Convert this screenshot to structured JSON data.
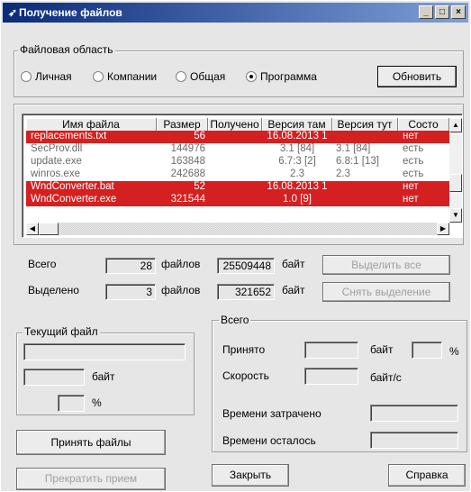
{
  "window": {
    "title": "Получение файлов",
    "btn_min": "_",
    "btn_max": "□",
    "btn_close": "×"
  },
  "area": {
    "legend": "Файловая область",
    "options": [
      "Личная",
      "Компании",
      "Общая",
      "Программа"
    ],
    "selected": "Программа",
    "refresh_label": "Обновить"
  },
  "files": {
    "columns": [
      "Имя файла",
      "Размер",
      "Получено",
      "Версия там",
      "Версия тут",
      "Состо"
    ],
    "rows": [
      {
        "name": "replacements.txt",
        "size": "56",
        "received": "",
        "ver_there": "16.08.2013 1",
        "ver_here": "",
        "state": "нет",
        "style": "red"
      },
      {
        "name": "SecProv.dll",
        "size": "144976",
        "received": "",
        "ver_there": "3.1 [84]",
        "ver_here": "3.1 [84]",
        "state": "есть",
        "style": "grey"
      },
      {
        "name": "update.exe",
        "size": "163848",
        "received": "",
        "ver_there": "6.7:3 [2]",
        "ver_here": "6.8:1 [13]",
        "state": "есть",
        "style": "grey"
      },
      {
        "name": "winros.exe",
        "size": "242688",
        "received": "",
        "ver_there": "2.3",
        "ver_here": "2.3",
        "state": "есть",
        "style": "grey"
      },
      {
        "name": "WndConverter.bat",
        "size": "52",
        "received": "",
        "ver_there": "16.08.2013 1",
        "ver_here": "",
        "state": "нет",
        "style": "red"
      },
      {
        "name": "WndConverter.exe",
        "size": "321544",
        "received": "",
        "ver_there": "1.0 [9]",
        "ver_here": "",
        "state": "нет",
        "style": "red"
      }
    ]
  },
  "totals": {
    "total_label": "Всего",
    "total_count": "28",
    "files_label": "файлов",
    "total_bytes": "25509448",
    "bytes_label": "байт",
    "selected_label": "Выделено",
    "selected_count": "3",
    "selected_bytes": "321652",
    "select_all_label": "Выделить все",
    "deselect_label": "Снять выделение"
  },
  "current": {
    "legend": "Текущий файл",
    "name_value": "",
    "bytes_value": "",
    "bytes_label": "байт",
    "percent_value": "",
    "percent_label": "%"
  },
  "overall": {
    "legend": "Всего",
    "received_label": "Принято",
    "received_value": "",
    "received_unit": "байт",
    "received_pct_value": "",
    "pct_label": "%",
    "speed_label": "Скорость",
    "speed_value": "",
    "speed_unit": "байт/с",
    "elapsed_label": "Времени затрачено",
    "elapsed_value": "",
    "remaining_label": "Времени осталось",
    "remaining_value": ""
  },
  "buttons": {
    "accept": "Принять файлы",
    "stop": "Прекратить прием",
    "close": "Закрыть",
    "help": "Справка"
  }
}
